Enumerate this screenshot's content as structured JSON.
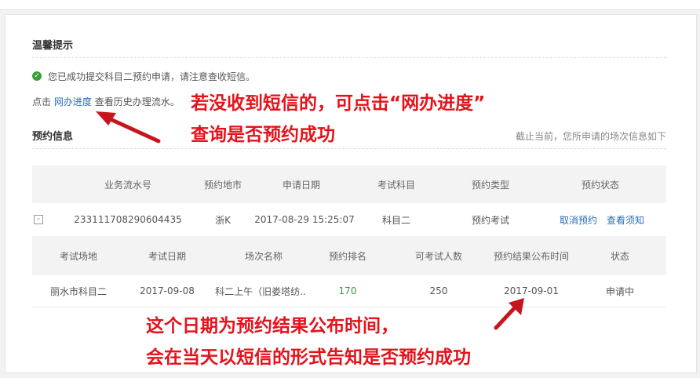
{
  "notice": {
    "title": "温馨提示",
    "success_message": "您已成功提交科目二预约申请，请注意查收短信。",
    "hint_prefix": "点击",
    "hint_link": "网办进度",
    "hint_suffix": "查看历史办理流水。"
  },
  "booking": {
    "title": "预约信息",
    "note": "截止当前，您所申请的场次信息如下",
    "main_headers": [
      "业务流水号",
      "预约地市",
      "申请日期",
      "考试科目",
      "预约类型",
      "预约状态"
    ],
    "main_row": {
      "expand_symbol": "-",
      "serial": "233111708290604435",
      "city": "浙K",
      "apply_date": "2017-08-29 15:25:07",
      "subject": "科目二",
      "type": "预约考试",
      "cancel_link": "取消预约",
      "notice_link": "查看须知"
    },
    "sub_headers": [
      "考试场地",
      "考试日期",
      "场次名称",
      "预约排名",
      "可考试人数",
      "预约结果公布时间",
      "状态"
    ],
    "sub_row": {
      "venue": "丽水市科目二",
      "exam_date": "2017-09-08",
      "session": "科二上午（旧娄塔纺..",
      "rank": "170",
      "capacity": "250",
      "publish_date": "2017-09-01",
      "status": "申请中"
    }
  },
  "annotations": {
    "top_line1": "若没收到短信的，可点击“网办进度”",
    "top_line2": "查询是否预约成功",
    "bottom_line1": "这个日期为预约结果公布时间，",
    "bottom_line2": "会在当天以短信的形式告知是否预约成功"
  },
  "colors": {
    "annotation": "#e5121b",
    "link": "#2b6bbf",
    "success": "#3a9e3a"
  }
}
